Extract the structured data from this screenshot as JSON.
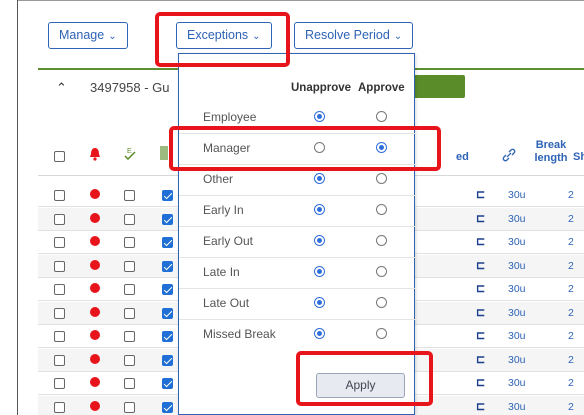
{
  "toolbar": {
    "manage_label": "Manage",
    "exceptions_label": "Exceptions",
    "resolve_label": "Resolve Period"
  },
  "group": {
    "title": "3497958 - Gu"
  },
  "columns": {
    "break_length": "Break length",
    "shift": "Shift",
    "partial": "ed"
  },
  "exceptions_menu": {
    "col_unapprove": "Unapprove",
    "col_approve": "Approve",
    "items": [
      {
        "label": "Employee",
        "selected": "Unapprove"
      },
      {
        "label": "Manager",
        "selected": "Approve"
      },
      {
        "label": "Other",
        "selected": "Unapprove"
      },
      {
        "label": "Early In",
        "selected": "Unapprove"
      },
      {
        "label": "Early Out",
        "selected": "Unapprove"
      },
      {
        "label": "Late In",
        "selected": "Unapprove"
      },
      {
        "label": "Late Out",
        "selected": "Unapprove"
      },
      {
        "label": "Missed Break",
        "selected": "Unapprove"
      }
    ],
    "apply_label": "Apply"
  },
  "rows": [
    {
      "break": "30u",
      "shift": "2"
    },
    {
      "break": "30u",
      "shift": "2"
    },
    {
      "break": "30u",
      "shift": "2"
    },
    {
      "break": "30u",
      "shift": "2"
    },
    {
      "break": "30u",
      "shift": "2"
    },
    {
      "break": "30u",
      "shift": "2"
    },
    {
      "break": "30u",
      "shift": "2"
    },
    {
      "break": "30u",
      "shift": "2"
    }
  ],
  "colors": {
    "accent": "#2e63b5",
    "highlight": "#e8141c",
    "green": "#5b8c2a"
  }
}
